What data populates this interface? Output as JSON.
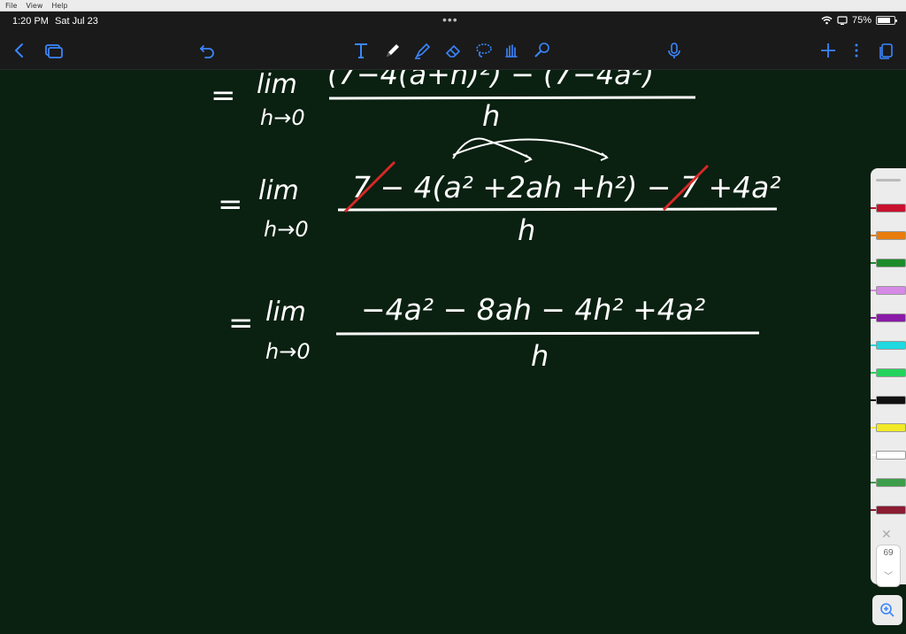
{
  "menubar": {
    "items": [
      "File",
      "View",
      "Help"
    ]
  },
  "status": {
    "time": "1:20 PM",
    "date": "Sat Jul 23",
    "battery": "75%",
    "battery_level": 0.75
  },
  "toolbar": {
    "icons": [
      "back-icon",
      "pages-icon",
      "undo-icon",
      "text-tool-icon",
      "pen-tool-icon",
      "highlighter-tool-icon",
      "eraser-tool-icon",
      "lasso-tool-icon",
      "shape-tool-icon",
      "laser-pointer-icon",
      "microphone-icon",
      "add-icon",
      "more-icon",
      "document-icon"
    ]
  },
  "palette": {
    "colors": [
      "#c8102e",
      "#e87d0d",
      "#1e8c2b",
      "#d58ae6",
      "#8a1aa8",
      "#1fd8e0",
      "#24d35c",
      "#111111",
      "#f2ea28",
      "#ffffff",
      "#3c9e4a",
      "#8b1a32"
    ]
  },
  "page_number": "69",
  "ink": {
    "line1_num": "(7−4(a+h)²) − (7−4a²)",
    "line1_den": "h",
    "line2_num": "7 − 4(a² +2ah +h²) − 7 +4a²",
    "line2_den": "h",
    "line3_num": "−4a² − 8ah − 4h² +4a²",
    "line3_den": "h",
    "lim_word": "lim",
    "lim_sub": "h→0",
    "equals": "="
  }
}
